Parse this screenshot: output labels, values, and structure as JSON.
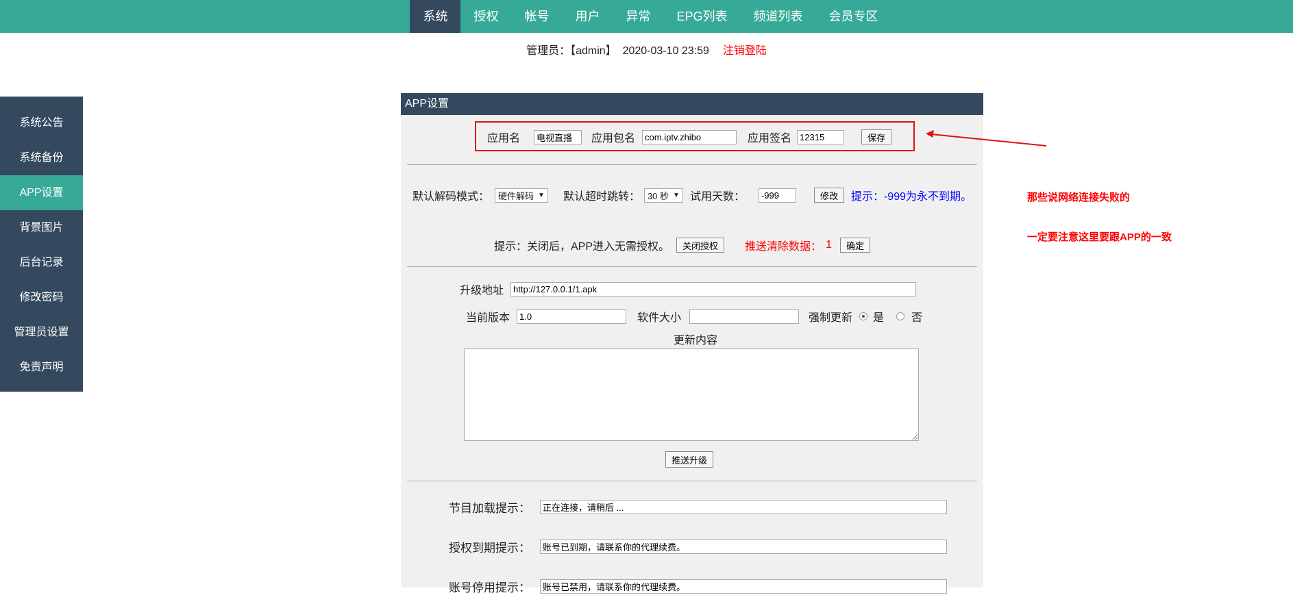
{
  "nav": [
    "系统",
    "授权",
    "帐号",
    "用户",
    "异常",
    "EPG列表",
    "频道列表",
    "会员专区"
  ],
  "admin": {
    "label": "管理员：",
    "name": "【admin】",
    "datetime": "2020-03-10 23:59",
    "logout": "注销登陆"
  },
  "sidebar": [
    "系统公告",
    "系统备份",
    "APP设置",
    "背景图片",
    "后台记录",
    "修改密码",
    "管理员设置",
    "免责声明"
  ],
  "panel": {
    "title": "APP设置",
    "app": {
      "name_label": "应用名",
      "name_value": "电视直播",
      "pkg_label": "应用包名",
      "pkg_value": "com.iptv.zhibo",
      "sign_label": "应用签名",
      "sign_value": "12315",
      "save": "保存"
    },
    "decode": {
      "label": "默认解码模式：",
      "value": "硬件解码",
      "timeout_label": "默认超时跳转：",
      "timeout_value": "30 秒",
      "trial_label": "试用天数：",
      "trial_value": "-999",
      "modify": "修改",
      "hint": "提示：-999为永不到期。"
    },
    "auth": {
      "hint": "提示：关闭后，APP进入无需授权。",
      "close": "关闭授权",
      "clear_label": "推送清除数据：",
      "clear_value": "1",
      "confirm": "确定"
    },
    "upgrade": {
      "url_label": "升级地址",
      "url_value": "http://127.0.0.1/1.apk",
      "ver_label": "当前版本",
      "ver_value": "1.0",
      "size_label": "软件大小",
      "size_value": "",
      "force_label": "强制更新",
      "yes": "是",
      "no": "否",
      "content_label": "更新内容",
      "content_value": "",
      "push": "推送升级"
    },
    "tips": [
      {
        "label": "节目加载提示：",
        "value": "正在连接，请稍后 ..."
      },
      {
        "label": "授权到期提示：",
        "value": "账号已到期，请联系你的代理续费。"
      },
      {
        "label": "账号停用提示：",
        "value": "账号已禁用，请联系你的代理续费。"
      }
    ]
  },
  "annotation": {
    "line1": "那些说网络连接失败的",
    "line2": "一定要注意这里要跟APP的一致"
  }
}
